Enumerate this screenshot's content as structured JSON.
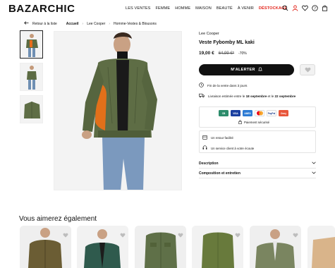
{
  "header": {
    "logo": "BAZARCHIC",
    "nav": [
      "LES VENTES",
      "FEMME",
      "HOMME",
      "MAISON",
      "BEAUTÉ",
      "À VENIR"
    ],
    "nav_highlight": "DÉSTOCKAGE",
    "accent_color": "#e2231a",
    "icons": [
      "search-icon",
      "user-icon",
      "heart-icon",
      "help-icon",
      "bag-icon"
    ]
  },
  "breadcrumb": {
    "back": "Retour à la liste",
    "items": [
      "Accueil",
      "Lee Cooper",
      "Homme-Vestes & Blousons"
    ]
  },
  "product": {
    "brand": "Lee Cooper",
    "name": "Veste Fybomby ML kaki",
    "price": "19,00 €",
    "old_price": "64,99 €*",
    "discount": "-70%",
    "alert_button": "M'ALERTER",
    "sale_end": "Fin de la vente dans 3 jours",
    "delivery_prefix": "Livraison estimée entre le ",
    "delivery_date1": "18 septembre",
    "delivery_mid": " et le ",
    "delivery_date2": "22 septembre",
    "payment_methods": [
      "CB",
      "VISA",
      "AMEX",
      "MC",
      "PayPal",
      "Oney"
    ],
    "secure_payment": "Paiement sécurisé",
    "return_easy": "Un retour facilité",
    "customer_service": "Un service client à votre écoute",
    "accordions": [
      "Description",
      "Composition et entretien"
    ]
  },
  "recommendations": {
    "title": "Vous aimerez également"
  }
}
